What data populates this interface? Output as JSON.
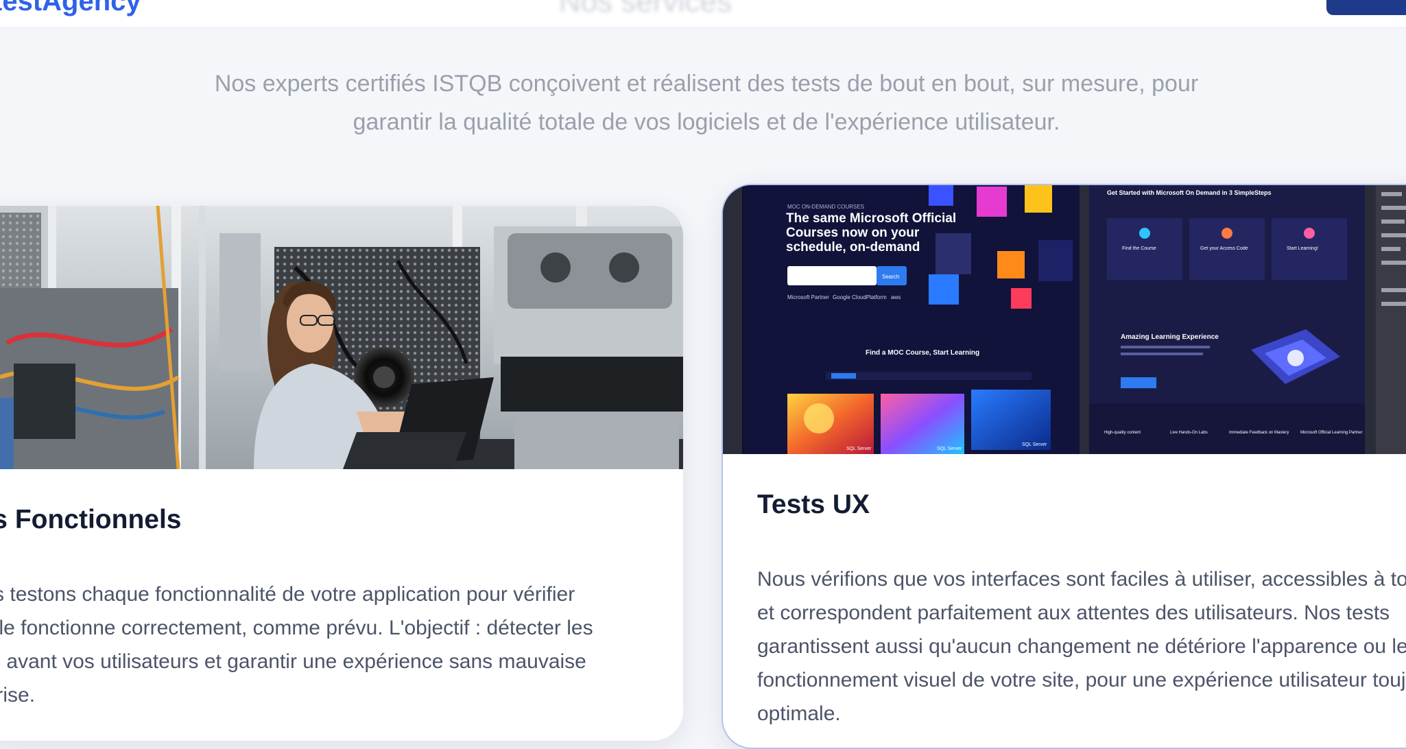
{
  "header": {
    "logo_text": "testAgency",
    "nav_blurred_text": "Nos services",
    "cta_label": ""
  },
  "intro": {
    "text": "Nos experts certifiés ISTQB conçoivent et réalisent des tests de bout en bout, sur mesure, pour garantir la qualité totale de vos logiciels et de l'expérience utilisateur."
  },
  "cards": [
    {
      "title": "Tests Fonctionnels",
      "description": "Nous testons chaque fonctionnalité de votre application pour vérifier qu'elle fonctionne correctement, comme prévu. L'objectif : détecter les bugs avant vos utilisateurs et garantir une expérience sans mauvaise surprise.",
      "image_alt": "Ingénieure testant du matériel avec un ordinateur portable dans un laboratoire"
    },
    {
      "title": "Tests UX",
      "description": "Nous vérifions que vos interfaces sont faciles à utiliser, accessibles à tous, et correspondent parfaitement aux attentes des utilisateurs. Nos tests garantissent aussi qu'aucun changement ne détériore l'apparence ou le fonctionnement visuel de votre site, pour une expérience utilisateur toujours optimale.",
      "image_alt": "Capture d'écran de maquettes de site web Microsoft On Demand"
    }
  ],
  "ux_mockup": {
    "eyebrow": "MOC ON-DEMAND COURSES",
    "hero": "The same Microsoft Official Courses now on your schedule, on-demand",
    "search_button": "Search",
    "find_title": "Find a MOC Course, Start Learning",
    "steps_title": "Get Started with Microsoft On Demand in 3 SimpleSteps",
    "step_labels": [
      "Find the Course",
      "Get your Access Code",
      "Start Learning!"
    ],
    "amazing_title": "Amazing Learning Experience",
    "tile_labels": [
      "SQL Server",
      "SQL Server",
      "SQL Server"
    ],
    "partner_logos": [
      "Microsoft Partner",
      "Google CloudPlatform",
      "aws"
    ],
    "feature_labels": [
      "High-quality content",
      "Live Hands-On Labs",
      "Immediate Feedback on Mastery",
      "Microsoft Official Learning Partner"
    ]
  },
  "colors": {
    "accent": "#2f62e8",
    "heading": "#141c33",
    "body_text": "#4b5468",
    "muted_text": "#9aa0ab",
    "card_border_active": "#b4c2ef"
  }
}
